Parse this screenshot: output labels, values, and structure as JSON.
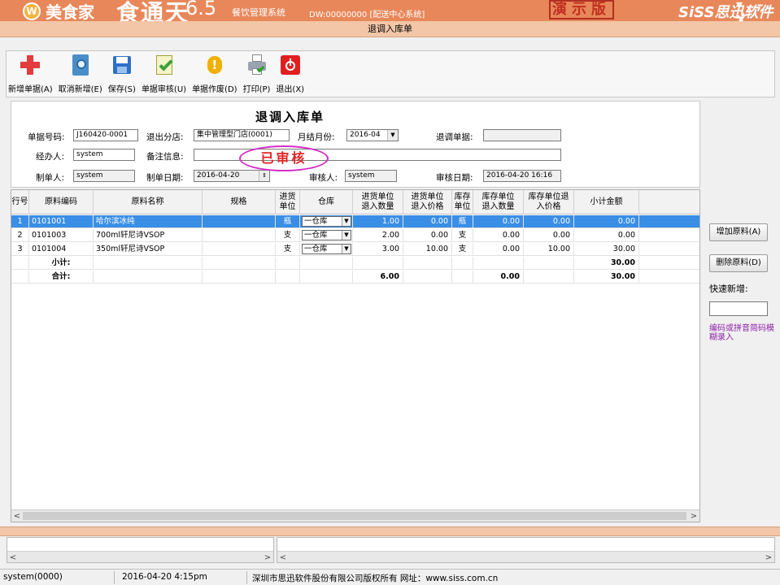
{
  "banner": {
    "logo_text": "W",
    "brand": "美食家",
    "product": "食通天",
    "version": "6.5",
    "system_name": "餐饮管理系统",
    "serial": "DW:00000000 [配送中心系统]",
    "demo_label": "演示版",
    "company_logo": "SiSS思迅软件",
    "window_controls": "▾ – X"
  },
  "window": {
    "title": "退调入库单"
  },
  "toolbar": {
    "items": [
      {
        "label": "新增单据(A)",
        "icon": "add-icon"
      },
      {
        "label": "取消新增(E)",
        "icon": "notebook-icon"
      },
      {
        "label": "保存(S)",
        "icon": "save-icon"
      },
      {
        "label": "单据审核(U)",
        "icon": "approve-icon"
      },
      {
        "label": "单据作废(D)",
        "icon": "void-icon"
      },
      {
        "label": "打印(P)",
        "icon": "printer-icon"
      },
      {
        "label": "退出(X)",
        "icon": "power-icon"
      }
    ]
  },
  "form": {
    "title": "退调入库单",
    "doc_no_label": "单据号码:",
    "doc_no": "J160420-0001",
    "branch_label": "退出分店:",
    "branch": "集中管理型门店(0001)",
    "month_label": "月结月份:",
    "month": "2016-04",
    "return_doc_label": "退调单据:",
    "return_doc": "",
    "handler_label": "经办人:",
    "handler": "system",
    "remark_label": "备注信息:",
    "remark": "",
    "maker_label": "制单人:",
    "maker": "system",
    "make_date_label": "制单日期:",
    "make_date": "2016-04-20",
    "auditor_label": "审核人:",
    "auditor": "system",
    "audit_date_label": "审核日期:",
    "audit_date": "2016-04-20 16:16",
    "stamp": "已审核"
  },
  "grid": {
    "headers": [
      "行号",
      "原料编码",
      "原料名称",
      "规格",
      "进货\n单位",
      "仓库",
      "进货单位\n退入数量",
      "进货单位\n退入价格",
      "库存\n单位",
      "库存单位\n退入数量",
      "库存单位退\n入价格",
      "小计金额"
    ],
    "rows": [
      {
        "no": "1",
        "code": "0101001",
        "name": "哈尔滨冰纯",
        "spec": "",
        "unit": "瓶",
        "warehouse": "一仓库",
        "qty": "1.00",
        "price": "0.00",
        "stock_unit": "瓶",
        "stock_qty": "0.00",
        "stock_price": "0.00",
        "amount": "0.00",
        "selected": true
      },
      {
        "no": "2",
        "code": "0101003",
        "name": "700ml轩尼诗VSOP",
        "spec": "",
        "unit": "支",
        "warehouse": "一仓库",
        "qty": "2.00",
        "price": "0.00",
        "stock_unit": "支",
        "stock_qty": "0.00",
        "stock_price": "0.00",
        "amount": "0.00",
        "selected": false
      },
      {
        "no": "3",
        "code": "0101004",
        "name": "350ml轩尼诗VSOP",
        "spec": "",
        "unit": "支",
        "warehouse": "一仓库",
        "qty": "3.00",
        "price": "10.00",
        "stock_unit": "支",
        "stock_qty": "0.00",
        "stock_price": "10.00",
        "amount": "30.00",
        "selected": false
      }
    ],
    "subtotal": {
      "label": "小计:",
      "amount": "30.00"
    },
    "total": {
      "label": "合计:",
      "qty": "6.00",
      "stock_qty": "0.00",
      "amount": "30.00"
    }
  },
  "side": {
    "add_label": "增加原料(A)",
    "del_label": "删除原料(D)",
    "quick_label": "快速新增:",
    "quick_value": "",
    "hint": "编码或拼音简码模糊录入",
    "hint_color": "#8b1fa5"
  },
  "status": {
    "user": "system(0000)",
    "datetime": "2016-04-20 4:15pm",
    "copyright": "深圳市思迅软件股份有限公司版权所有 网址：www.siss.com.cn"
  },
  "colors": {
    "banner": "#e8875a",
    "titlebar": "#f2c6a6",
    "selection": "#3a8ee6",
    "stamp_ring": "#d52dc8",
    "stamp_text": "#e02424"
  }
}
